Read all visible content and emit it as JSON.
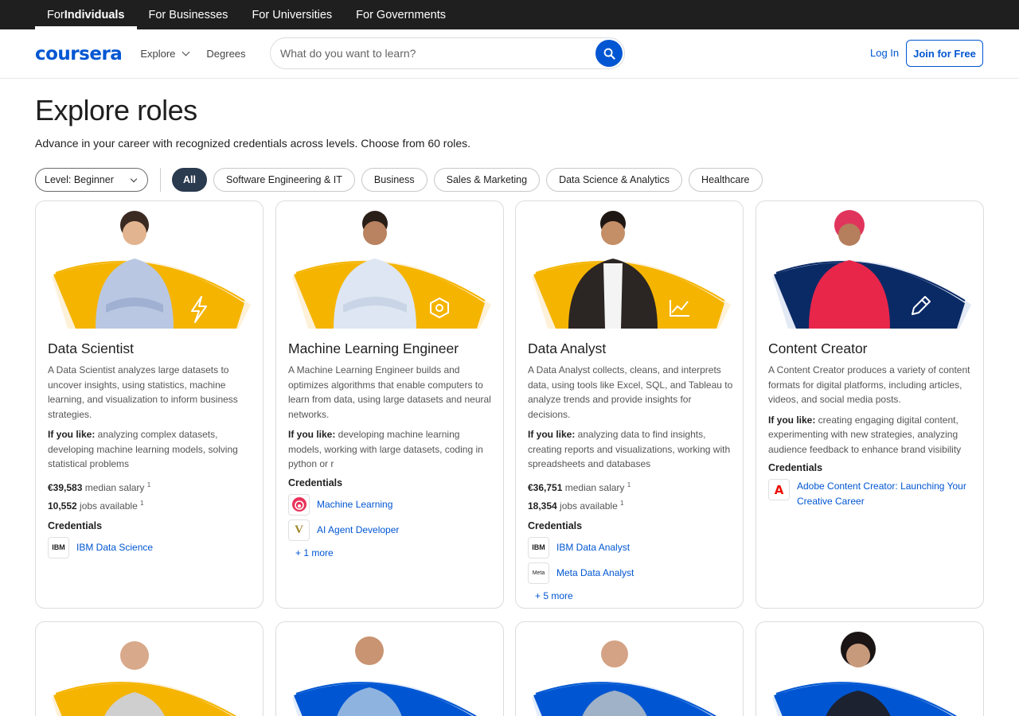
{
  "topbar": {
    "items": [
      {
        "label_pre": "For ",
        "label_main": "Individuals",
        "active": true
      },
      {
        "label": "For Businesses"
      },
      {
        "label": "For Universities"
      },
      {
        "label": "For Governments"
      }
    ]
  },
  "header": {
    "logo": "coursera",
    "explore": "Explore",
    "degrees": "Degrees",
    "search_placeholder": "What do you want to learn?",
    "login": "Log In",
    "join": "Join for Free"
  },
  "page": {
    "title": "Explore roles",
    "subtitle": "Advance in your career with recognized credentials across levels. Choose from 60 roles."
  },
  "filters": {
    "level": "Level: Beginner",
    "chips": [
      "All",
      "Software Engineering & IT",
      "Business",
      "Sales & Marketing",
      "Data Science & Analytics",
      "Healthcare"
    ]
  },
  "colors": {
    "brand": "#0056d2",
    "gold": "#f5b400",
    "navy": "#0a2a66"
  },
  "cards": [
    {
      "title": "Data Scientist",
      "desc": "A Data Scientist analyzes large datasets to uncover insights, using statistics, machine learning, and visualization to inform business strategies.",
      "like_label": "If you like:",
      "like": " analyzing complex datasets, developing machine learning models, solving statistical problems",
      "salary": "€39,583",
      "salary_label": " median salary ",
      "jobs": "10,552",
      "jobs_label": " jobs available ",
      "note": "1",
      "cred_header": "Credentials",
      "creds": [
        {
          "logo": "IBM",
          "name": "IBM Data Science"
        }
      ],
      "more": "",
      "icon": "lightning-icon"
    },
    {
      "title": "Machine Learning Engineer",
      "desc": "A Machine Learning Engineer builds and optimizes algorithms that enable computers to learn from data, using large datasets and neural networks.",
      "like_label": "If you like:",
      "like": " developing machine learning models, working with large datasets, coding in python or r",
      "cred_header": "Credentials",
      "creds": [
        {
          "logo": "",
          "name": "Machine Learning"
        },
        {
          "logo": "V",
          "name": "AI Agent Developer"
        }
      ],
      "more": "+ 1 more",
      "icon": "hexagon-icon"
    },
    {
      "title": "Data Analyst",
      "desc": "A Data Analyst collects, cleans, and interprets data, using tools like Excel, SQL, and Tableau to analyze trends and provide insights for decisions.",
      "like_label": "If you like:",
      "like": " analyzing data to find insights, creating reports and visualizations, working with spreadsheets and databases",
      "salary": "€36,751",
      "salary_label": " median salary ",
      "jobs": "18,354",
      "jobs_label": " jobs available ",
      "note": "1",
      "cred_header": "Credentials",
      "creds": [
        {
          "logo": "IBM",
          "name": "IBM Data Analyst"
        },
        {
          "logo": "Meta",
          "name": "Meta Data Analyst"
        }
      ],
      "more": "+ 5 more",
      "icon": "line-chart-icon"
    },
    {
      "title": "Content Creator",
      "desc": "A Content Creator produces a variety of content formats for digital platforms, including articles, videos, and social media posts.",
      "like_label": "If you like:",
      "like": " creating engaging digital content, experimenting with new strategies, analyzing audience feedback to enhance brand visibility",
      "cred_header": "Credentials",
      "creds": [
        {
          "logo": "A",
          "name": "Adobe Content Creator: Launching Your Creative Career"
        }
      ],
      "more": "",
      "icon": "pencil-icon"
    }
  ]
}
